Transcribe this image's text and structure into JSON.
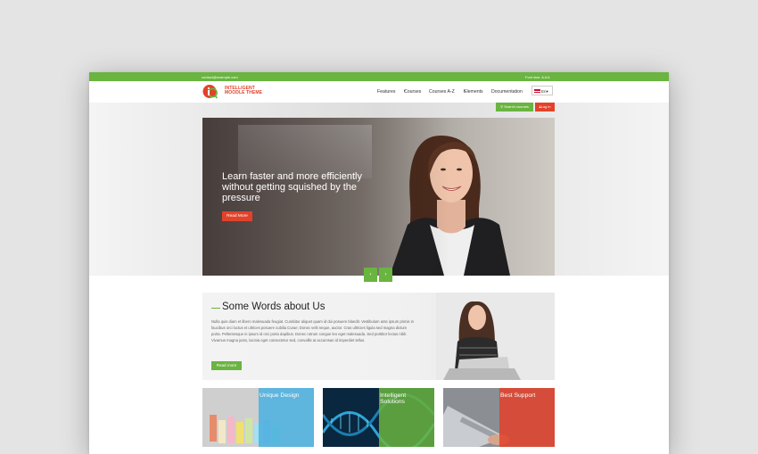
{
  "topbar": {
    "email": "contact@example.com",
    "font_size_label": "Font size: A A A"
  },
  "header": {
    "logo_line1": "INTELLIGENT",
    "logo_line2": "MOODLE THEME",
    "nav": [
      "Features",
      "Courses",
      "Courses A-Z",
      "Elements",
      "Documentation"
    ],
    "lang": "En"
  },
  "actions": {
    "search_courses": "Search courses",
    "login": "Log in"
  },
  "hero": {
    "headline": "Learn faster and more efficiently without getting squished by the pressure",
    "read_more": "Read More"
  },
  "slider": {
    "prev": "‹",
    "next": "›"
  },
  "about": {
    "title": "Some Words about Us",
    "body": "Nulla quis diam et libero malesuada feugiat. Curabitur aliquet quam id dui posuere blandit. Vestibulum ante ipsum primis in faucibus orci luctus et ultrices posuere cubilia Curae; Donec velit neque, auctor. Cras ultricies ligula sed magna dictum porta. Pellentesque in ipsum id orci porta dapibus. Donec rutrum congue leo eget malesuada. Sed porttitor lectus nibh. Vivamus magna justo, lacinia eget consectetur sed, convallis at accumsan id imperdiet tellus.",
    "read_more": "Read more"
  },
  "features": [
    {
      "title": "Unique Design",
      "color": "#4ab0e0"
    },
    {
      "title": "Intelligent Solutions",
      "color": "#6ab440"
    },
    {
      "title": "Best Support",
      "color": "#e2422a"
    }
  ],
  "colors": {
    "green": "#6ab440",
    "red": "#e2422a",
    "blue": "#4ab0e0"
  }
}
